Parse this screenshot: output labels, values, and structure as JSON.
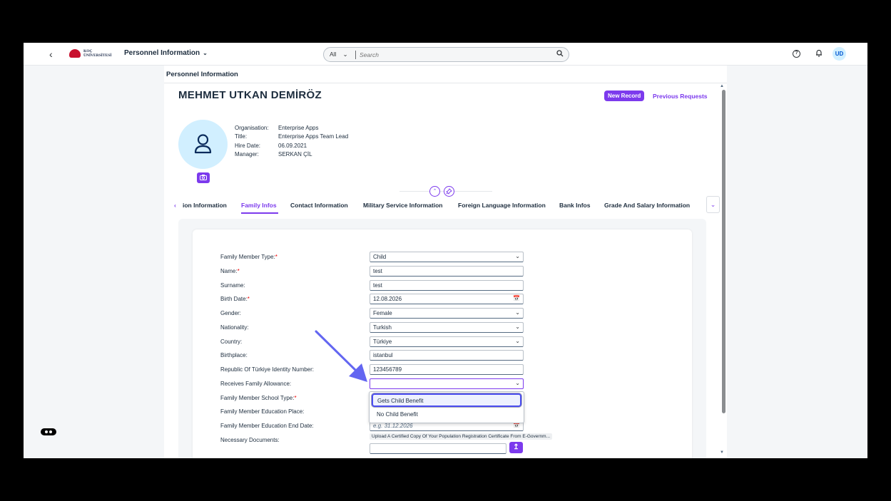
{
  "shell": {
    "back": "‹",
    "logo_line1": "KOÇ",
    "logo_line2": "ÜNİVERSİTESİ",
    "app_title": "Personnel Information",
    "search_scope": "All",
    "search_placeholder": "Search",
    "user_initials": "UD"
  },
  "page": {
    "heading": "Personnel Information",
    "person_name": "MEHMET UTKAN DEMİRÖZ",
    "new_record": "New Record",
    "previous_requests": "Previous Requests",
    "info": [
      {
        "label": "Organisation:",
        "value": "Enterprise Apps"
      },
      {
        "label": "Title:",
        "value": "Enterprise Apps Team Lead"
      },
      {
        "label": "Hire Date:",
        "value": "06.09.2021"
      },
      {
        "label": "Manager:",
        "value": "SERKAN ÇİL"
      }
    ]
  },
  "tabs": [
    {
      "label": "ion Information",
      "active": false
    },
    {
      "label": "Family Infos",
      "active": true
    },
    {
      "label": "Contact Information",
      "active": false
    },
    {
      "label": "Military Service Information",
      "active": false
    },
    {
      "label": "Foreign Language Information",
      "active": false
    },
    {
      "label": "Bank Infos",
      "active": false
    },
    {
      "label": "Grade And Salary Information",
      "active": false
    }
  ],
  "form": {
    "fields": [
      {
        "label": "Family Member Type:",
        "required": true,
        "value": "Child",
        "type": "select"
      },
      {
        "label": "Name:",
        "required": true,
        "value": "test",
        "type": "text"
      },
      {
        "label": "Surname:",
        "required": false,
        "value": "test",
        "type": "text"
      },
      {
        "label": "Birth Date:",
        "required": true,
        "value": "12.08.2026",
        "type": "date"
      },
      {
        "label": "Gender:",
        "required": false,
        "value": "Female",
        "type": "select"
      },
      {
        "label": "Nationality:",
        "required": false,
        "value": "Turkish",
        "type": "select"
      },
      {
        "label": "Country:",
        "required": false,
        "value": "Türkiye",
        "type": "select"
      },
      {
        "label": "Birthplace:",
        "required": false,
        "value": "istanbul",
        "type": "text"
      },
      {
        "label": "Republic Of Türkiye Identity Number:",
        "required": false,
        "value": "123456789",
        "type": "text"
      },
      {
        "label": "Receives Family Allowance:",
        "required": false,
        "value": "",
        "type": "select"
      },
      {
        "label": "Family Member School Type:",
        "required": true,
        "value": "",
        "type": "hidden"
      },
      {
        "label": "Family Member Education Place:",
        "required": false,
        "value": "",
        "type": "hidden"
      },
      {
        "label": "Family Member Education End Date:",
        "required": false,
        "value": "",
        "placeholder": "e.g. 31.12.2026",
        "type": "date"
      },
      {
        "label": "Necessary Documents:",
        "required": false,
        "value": "",
        "type": "upload"
      }
    ],
    "allowance_options": [
      "Gets Child Benefit",
      "No Child Benefit"
    ],
    "documents_note": "Upload A Certified Copy Of Your Population Registration Certificate From E-Governm..."
  },
  "colors": {
    "accent": "#7c3aed",
    "highlight": "#4b4df0"
  }
}
